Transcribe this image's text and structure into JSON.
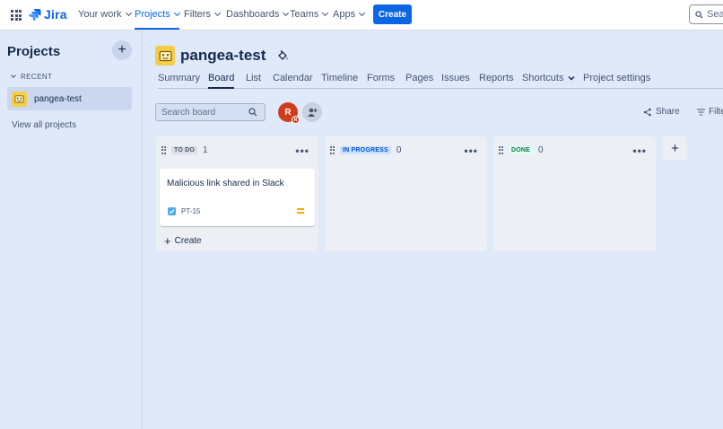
{
  "topnav": {
    "logo": "Jira",
    "items": [
      {
        "label": "Your work"
      },
      {
        "label": "Projects"
      },
      {
        "label": "Filters"
      },
      {
        "label": "Dashboards"
      },
      {
        "label": "Teams"
      },
      {
        "label": "Apps"
      }
    ],
    "active_item": "Projects",
    "create_label": "Create",
    "search_placeholder": "Sea"
  },
  "sidebar": {
    "title": "Projects",
    "recent_label": "RECENT",
    "project_name": "pangea-test",
    "view_all": "View all projects"
  },
  "project": {
    "name": "pangea-test",
    "tabs": [
      {
        "label": "Summary"
      },
      {
        "label": "Board"
      },
      {
        "label": "List"
      },
      {
        "label": "Calendar"
      },
      {
        "label": "Timeline"
      },
      {
        "label": "Forms"
      },
      {
        "label": "Pages"
      },
      {
        "label": "Issues"
      },
      {
        "label": "Reports"
      },
      {
        "label": "Shortcuts"
      },
      {
        "label": "Project settings"
      }
    ],
    "active_tab": "Board"
  },
  "toolbar": {
    "search_placeholder": "Search board",
    "avatar_initial": "R",
    "avatar_sub": "R",
    "share_label": "Share",
    "filter_label": "Filte"
  },
  "columns": [
    {
      "status": "TO DO",
      "count": "1",
      "lozenge_bg": "#dcdfe4",
      "lozenge_color": "#44546f"
    },
    {
      "status": "IN PROGRESS",
      "count": "0",
      "lozenge_bg": "#cce0ff",
      "lozenge_color": "#0055cc"
    },
    {
      "status": "DONE",
      "count": "0",
      "lozenge_bg": "#dcfff1",
      "lozenge_color": "#216e4e"
    }
  ],
  "card": {
    "title": "Malicious link shared in Slack",
    "key": "PT-15",
    "create_label": "Create"
  },
  "colors": {
    "accent": "#0c66e4",
    "background": "#dfe9fa",
    "avatar": "#cf3e1c",
    "project_icon": "#f5cd47"
  }
}
